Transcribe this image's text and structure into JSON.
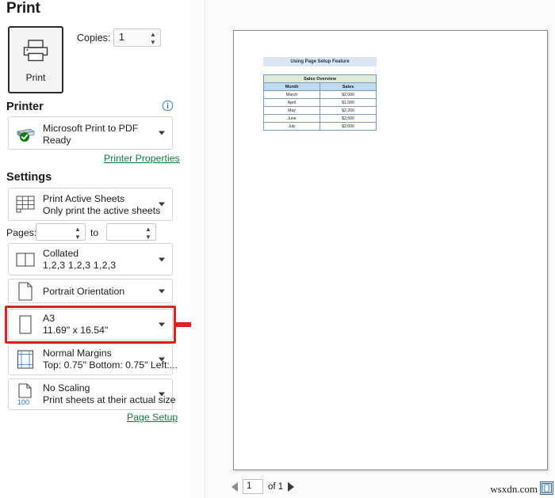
{
  "window": {
    "title": "Print"
  },
  "print_action": {
    "button_label": "Print",
    "icon": "printer-icon",
    "copies_label": "Copies:",
    "copies_value": "1"
  },
  "printer_section": {
    "heading": "Printer",
    "info_icon": "info-icon",
    "selected_printer": "Microsoft Print to PDF",
    "status": "Ready",
    "printer_icon": "printer-ready-icon",
    "properties_link": "Printer Properties"
  },
  "settings_section": {
    "heading": "Settings",
    "print_what": {
      "icon": "worksheet-grid-icon",
      "title": "Print Active Sheets",
      "description": "Only print the active sheets"
    },
    "pages": {
      "label": "Pages:",
      "from_value": "",
      "to_label": "to",
      "to_value": ""
    },
    "collation": {
      "icon": "collate-pages-icon",
      "title": "Collated",
      "description": "1,2,3   1,2,3   1,2,3"
    },
    "orientation": {
      "icon": "portrait-page-icon",
      "title": "Portrait Orientation"
    },
    "paper_size": {
      "icon": "paper-sheet-icon",
      "title": "A3",
      "description": "11.69\" x 16.54\"",
      "highlighted": true,
      "highlight_color": "#e02020"
    },
    "margins": {
      "icon": "margins-icon",
      "title": "Normal Margins",
      "description": "Top: 0.75\" Bottom: 0.75\" Left:..."
    },
    "scaling": {
      "icon": "no-scaling-icon",
      "icon_badge": "100",
      "title": "No Scaling",
      "description": "Print sheets at their actual size"
    },
    "page_setup_link": "Page Setup"
  },
  "annotation": {
    "arrow": "red-arrow-pointing-right",
    "color": "#e02020"
  },
  "preview": {
    "document": {
      "title_banner": "Using Page Setup Feature",
      "table": {
        "overview_header": "Sales Overview",
        "columns": [
          "Month",
          "Sales"
        ],
        "rows": [
          [
            "March",
            "$2,000"
          ],
          [
            "April",
            "$1,500"
          ],
          [
            "May",
            "$2,200"
          ],
          [
            "June",
            "$2,500"
          ],
          [
            "July",
            "$2,600"
          ]
        ]
      }
    },
    "navigation": {
      "prev_icon": "previous-page-arrow",
      "page_number": "1",
      "page_count_label": "of 1",
      "next_icon": "next-page-arrow"
    },
    "zoom_to_page_icon": "zoom-to-page-icon",
    "watermark": "wsxdn.com"
  },
  "colors": {
    "accent_green": "#107c41",
    "highlight_red": "#e02020",
    "table_header_blue": "#bfd9ee",
    "table_overview_green": "#dfeadb",
    "title_band_blue": "#dbe6f2"
  }
}
